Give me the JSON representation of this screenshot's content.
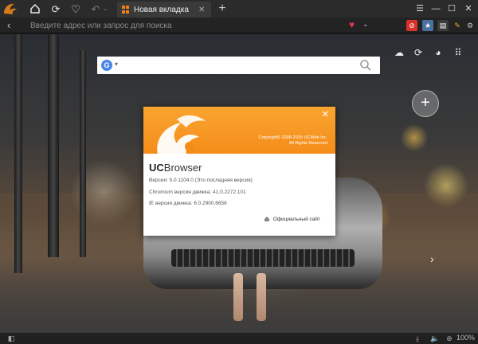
{
  "tab": {
    "title": "Новая вкладка"
  },
  "address_bar": {
    "placeholder": "Введите адрес или запрос для поиска"
  },
  "about_dialog": {
    "copyright_line1": "Copyright© 2008-2015 UCWeb Inc.",
    "copyright_line2": "All Rights Reserved",
    "brand_uc": "UC",
    "brand_name": "Browser",
    "version": "Версия: 5.0.1104.0 (Это последняя версия)",
    "chromium": "Chromium версия движка: 41.0.2272.101",
    "ie": "IE версия движка: 6.0.2900.6656",
    "official_site": "Официальный сайт"
  },
  "status_bar": {
    "zoom": "100%"
  },
  "colors": {
    "brand_orange": "#f58c1a",
    "heart_red": "#e0384a",
    "tab_bg": "#3a3a3a"
  }
}
